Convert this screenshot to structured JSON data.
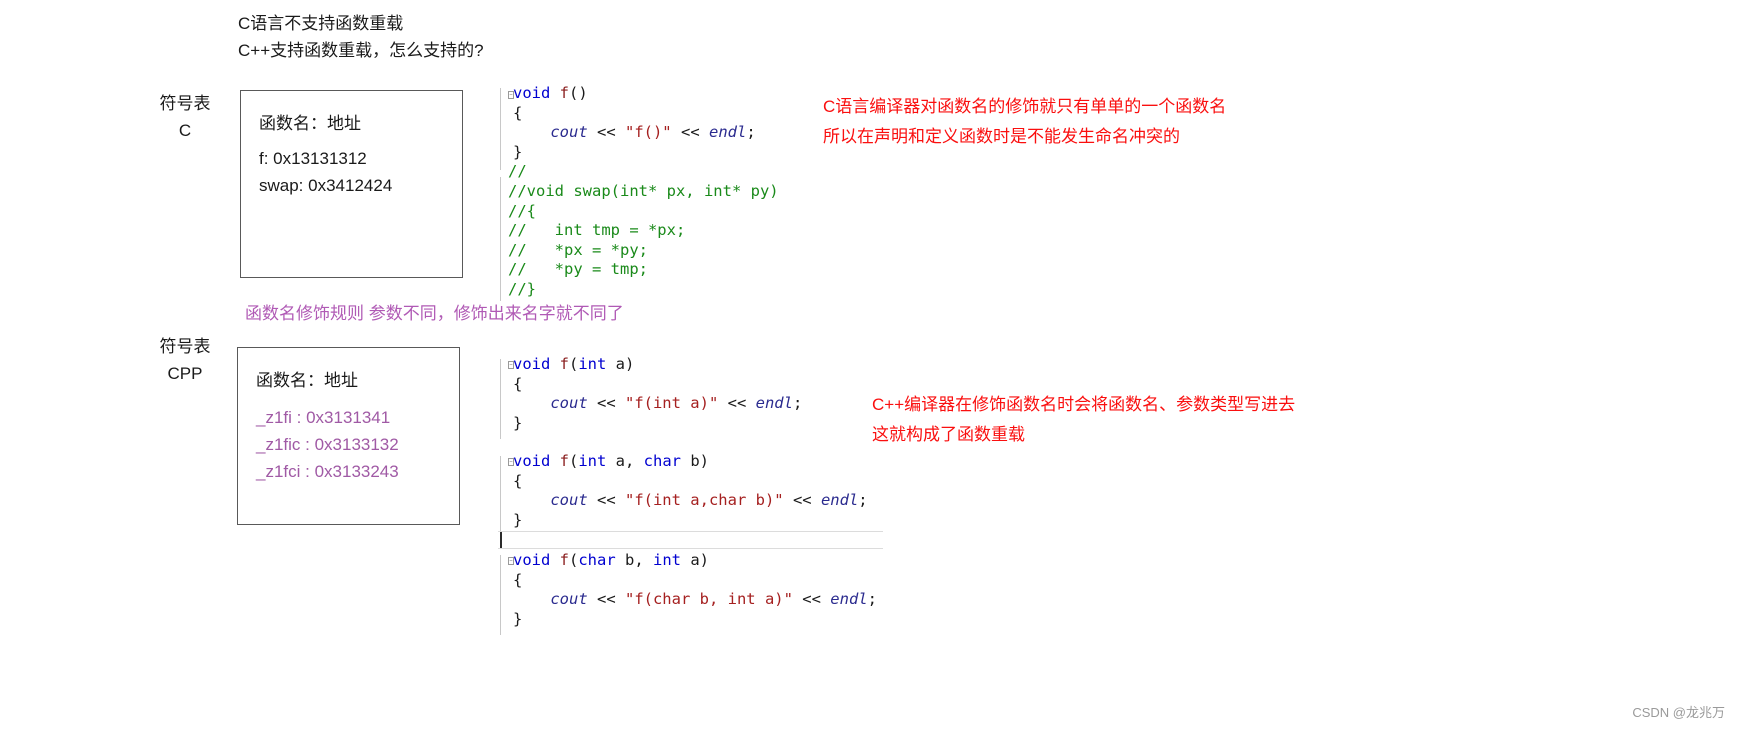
{
  "header": {
    "lines": [
      "C语言不支持函数重载",
      "C++支持函数重载，怎么支持的?"
    ]
  },
  "symbol_tables": [
    {
      "label_line1": "符号表",
      "label_line2": "C",
      "header": "函数名：地址",
      "rows": [
        "f:  0x13131312",
        "swap: 0x3412424"
      ]
    },
    {
      "label_line1": "符号表",
      "label_line2": "CPP",
      "header": "函数名：地址",
      "rows": [
        "_z1fi : 0x3131341",
        "_z1fic : 0x3133132",
        "_z1fci : 0x3133243"
      ]
    }
  ],
  "code_c": {
    "l1_kw": "void",
    "l1_fn": " f",
    "l1_pl": "()",
    "l2": "{",
    "l3_indent": "    ",
    "l3_obj1": "cout",
    "l3_op1": " << ",
    "l3_str": "\"f()\"",
    "l3_op2": " << ",
    "l3_obj2": "endl",
    "l3_end": ";",
    "l4": "}",
    "c1": "//",
    "c2": "//void swap(int* px, int* py)",
    "c3": "//{",
    "c4": "//   int tmp = *px;",
    "c5": "//   *px = *py;",
    "c6": "//   *py = tmp;",
    "c7": "//}"
  },
  "code_cpp": {
    "b1": {
      "l1_kw": "void",
      "l1_fn": " f",
      "l1_p1": "(",
      "l1_kw2": "int",
      "l1_p2": " a)",
      "l2": "{",
      "l3_obj1": "cout",
      "l3_op1": " << ",
      "l3_str": "\"f(int a)\"",
      "l3_op2": " << ",
      "l3_obj2": "endl",
      "l3_end": ";",
      "l4": "}"
    },
    "b2": {
      "l1_kw": "void",
      "l1_fn": " f",
      "l1_p1": "(",
      "l1_kw2": "int",
      "l1_p2": " a, ",
      "l1_kw3": "char",
      "l1_p3": " b)",
      "l2": "{",
      "l3_obj1": "cout",
      "l3_op1": " << ",
      "l3_str": "\"f(int a,char b)\"",
      "l3_op2": " << ",
      "l3_obj2": "endl",
      "l3_end": ";",
      "l4": "}"
    },
    "b3": {
      "l1_kw": "void",
      "l1_fn": " f",
      "l1_p1": "(",
      "l1_kw2": "char",
      "l1_p2": " b, ",
      "l1_kw3": "int",
      "l1_p3": " a)",
      "l2": "{",
      "l3_obj1": "cout",
      "l3_op1": " << ",
      "l3_str": "\"f(char b, int a)\"",
      "l3_op2": " << ",
      "l3_obj2": "endl",
      "l3_end": ";",
      "l4": "}"
    }
  },
  "annotations": {
    "c_note_line1": "C语言编译器对函数名的修饰就只有单单的一个函数名",
    "c_note_line2": "所以在声明和定义函数时是不能发生命名冲突的",
    "mangling_rule": "函数名修饰规则  参数不同，修饰出来名字就不同了",
    "cpp_note_line1": "C++编译器在修饰函数名时会将函数名、参数类型写进去",
    "cpp_note_line2": "这就构成了函数重载"
  },
  "watermark": "CSDN @龙兆万",
  "colors": {
    "red": "#fa0f0f",
    "purple": "#b05ab5",
    "keyword_blue": "#0000d0",
    "string_red": "#a52020",
    "comment_green": "#1a8a1a",
    "obj_blue": "#2b2b8f",
    "box_border": "#595959"
  }
}
